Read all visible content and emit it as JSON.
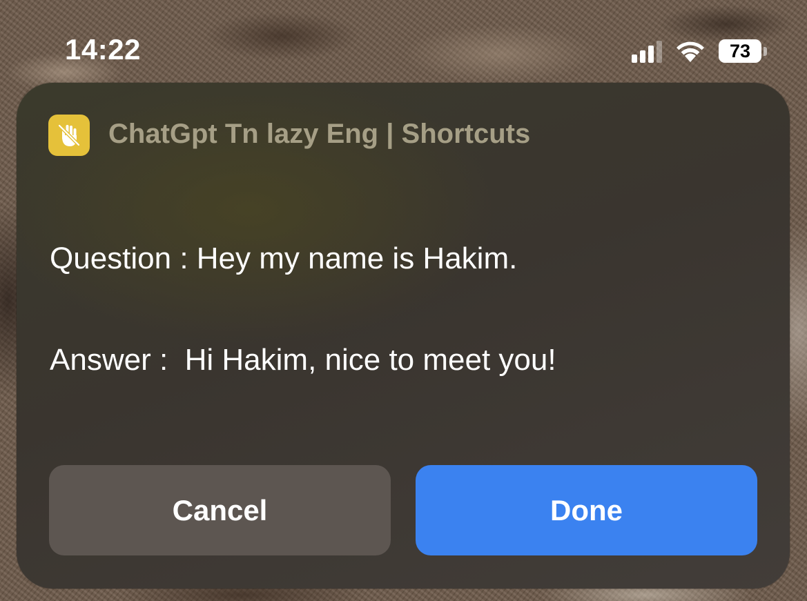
{
  "status_bar": {
    "time": "14:22",
    "battery_percent": "73",
    "signal_bars_active": 3,
    "signal_bars_total": 4,
    "icons": [
      "cellular-signal-icon",
      "wifi-icon",
      "battery-icon"
    ]
  },
  "alert": {
    "app_icon": "hand-slash-icon",
    "app_icon_color": "#e5c13a",
    "app_title": "ChatGpt Tn lazy Eng | Shortcuts",
    "question_line": "Question : Hey my name is Hakim.",
    "answer_line": "Answer :  Hi Hakim, nice to meet you!",
    "cancel_label": "Cancel",
    "done_label": "Done",
    "done_color": "#3b82f0"
  }
}
